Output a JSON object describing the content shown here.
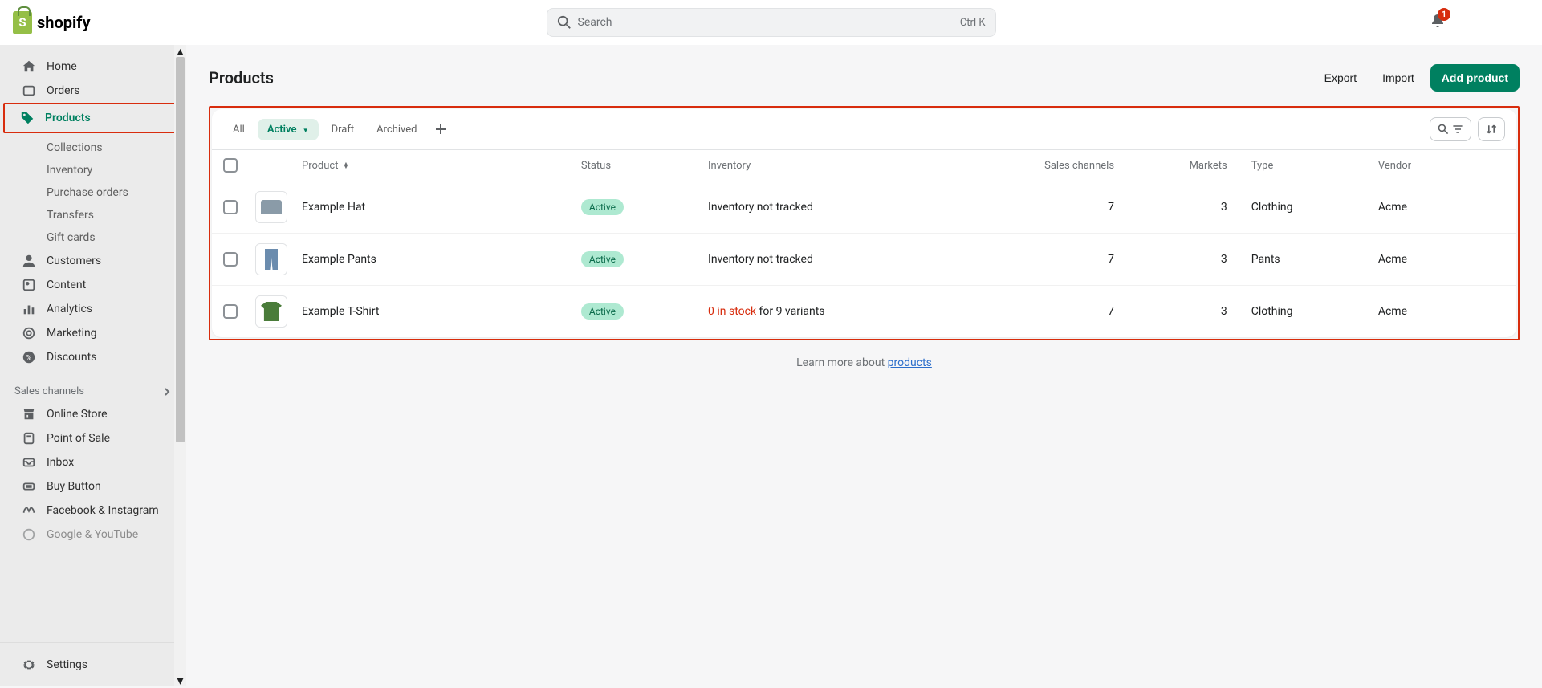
{
  "brand": "shopify",
  "search": {
    "placeholder": "Search",
    "shortcut": "Ctrl K"
  },
  "notifications": {
    "count": "1"
  },
  "sidebar": {
    "primary": [
      {
        "label": "Home",
        "icon": "home"
      },
      {
        "label": "Orders",
        "icon": "orders"
      },
      {
        "label": "Products",
        "icon": "tag",
        "active": true,
        "children": [
          {
            "label": "Collections"
          },
          {
            "label": "Inventory"
          },
          {
            "label": "Purchase orders"
          },
          {
            "label": "Transfers"
          },
          {
            "label": "Gift cards"
          }
        ]
      },
      {
        "label": "Customers",
        "icon": "person"
      },
      {
        "label": "Content",
        "icon": "content"
      },
      {
        "label": "Analytics",
        "icon": "analytics"
      },
      {
        "label": "Marketing",
        "icon": "marketing"
      },
      {
        "label": "Discounts",
        "icon": "discount"
      }
    ],
    "channels_label": "Sales channels",
    "channels": [
      {
        "label": "Online Store",
        "icon": "store"
      },
      {
        "label": "Point of Sale",
        "icon": "pos"
      },
      {
        "label": "Inbox",
        "icon": "inbox"
      },
      {
        "label": "Buy Button",
        "icon": "buybtn"
      },
      {
        "label": "Facebook & Instagram",
        "icon": "meta"
      },
      {
        "label": "Google & YouTube",
        "icon": "google"
      }
    ],
    "settings": "Settings"
  },
  "page": {
    "title": "Products",
    "actions": {
      "export": "Export",
      "import": "Import",
      "add": "Add product"
    }
  },
  "tabs": [
    {
      "label": "All"
    },
    {
      "label": "Active",
      "active": true
    },
    {
      "label": "Draft"
    },
    {
      "label": "Archived"
    }
  ],
  "columns": {
    "product": "Product",
    "status": "Status",
    "inventory": "Inventory",
    "channels": "Sales channels",
    "markets": "Markets",
    "type": "Type",
    "vendor": "Vendor"
  },
  "rows": [
    {
      "name": "Example Hat",
      "status": "Active",
      "inventory_plain": "Inventory not tracked",
      "channels": "7",
      "markets": "3",
      "type": "Clothing",
      "vendor": "Acme",
      "thumb": "hat"
    },
    {
      "name": "Example Pants",
      "status": "Active",
      "inventory_plain": "Inventory not tracked",
      "channels": "7",
      "markets": "3",
      "type": "Pants",
      "vendor": "Acme",
      "thumb": "pants"
    },
    {
      "name": "Example T-Shirt",
      "status": "Active",
      "inventory_warn": "0 in stock",
      "inventory_rest": " for 9 variants",
      "channels": "7",
      "markets": "3",
      "type": "Clothing",
      "vendor": "Acme",
      "thumb": "tee"
    }
  ],
  "footer": {
    "prefix": "Learn more about ",
    "link": "products"
  }
}
